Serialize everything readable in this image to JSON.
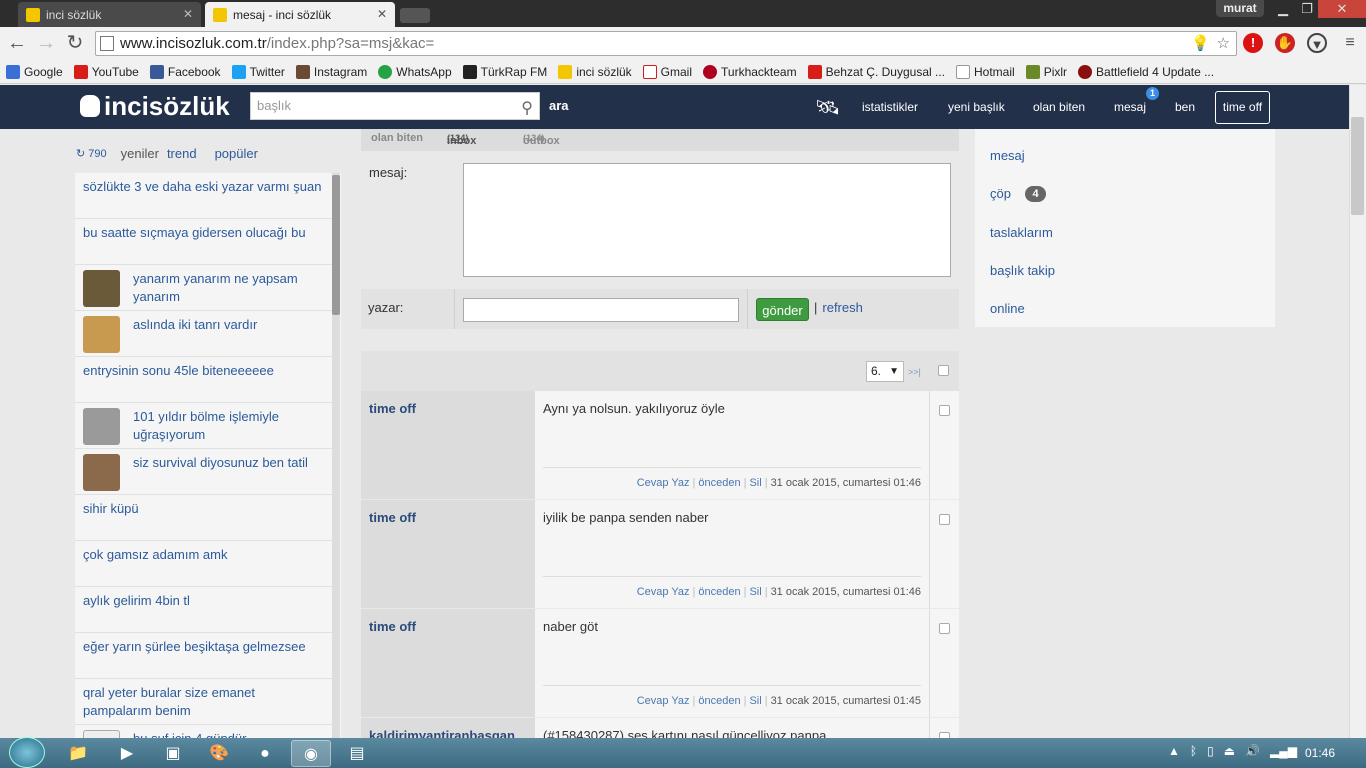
{
  "browser": {
    "tabs": [
      {
        "title": "inci sözlük"
      },
      {
        "title": "mesaj - inci sözlük"
      }
    ],
    "user": "murat",
    "url_host": "www.incisozluk.com.tr",
    "url_path": "/index.php?sa=msj&kac=",
    "bookmarks": [
      {
        "label": "Google",
        "color": "#3b6fd8"
      },
      {
        "label": "YouTube",
        "color": "#d91e18"
      },
      {
        "label": "Facebook",
        "color": "#3b5998"
      },
      {
        "label": "Twitter",
        "color": "#1da1f2"
      },
      {
        "label": "Instagram",
        "color": "#6b4a35"
      },
      {
        "label": "WhatsApp",
        "color": "#25a244"
      },
      {
        "label": "TürkRap FM",
        "color": "#222222"
      },
      {
        "label": "inci sözlük",
        "color": "#f2c600"
      },
      {
        "label": "Gmail",
        "color": "#c5221f"
      },
      {
        "label": "Turkhackteam",
        "color": "#b00020"
      },
      {
        "label": "Behzat Ç. Duygusal ...",
        "color": "#d91e18"
      },
      {
        "label": "Hotmail",
        "color": "#ffffff"
      },
      {
        "label": "Pixlr",
        "color": "#6a8a2a"
      },
      {
        "label": "Battlefield 4 Update ...",
        "color": "#8a1010"
      }
    ]
  },
  "site": {
    "logo": "incisözlük",
    "search_placeholder": "başlık",
    "search_button": "ara",
    "nav": {
      "istatistikler": "istatistikler",
      "yeni_baslik": "yeni başlık",
      "olan_biten": "olan biten",
      "mesaj": "mesaj",
      "mesaj_badge": "1",
      "ben": "ben",
      "time_off": "time off"
    }
  },
  "left": {
    "count": "790",
    "tabs": {
      "yeniler": "yeniler",
      "trend": "trend",
      "populer": "popüler"
    },
    "items": [
      {
        "text": "sözlükte 3 ve daha eski yazar varmı şuan"
      },
      {
        "text": "bu saatte sıçmaya gidersen olucağı bu"
      },
      {
        "text": "yanarım yanarım ne yapsam yanarım"
      },
      {
        "text": "aslında iki tanrı vardır"
      },
      {
        "text": "entrysinin sonu 45le biteneeeeee"
      },
      {
        "text": "101 yıldır bölme işlemiyle uğraşıyorum"
      },
      {
        "text": "siz survival diyosunuz ben tatil"
      },
      {
        "text": "sihir küpü"
      },
      {
        "text": "çok gamsız adamım amk"
      },
      {
        "text": "aylık gelirim 4bin tl"
      },
      {
        "text": "eğer yarın şürlee beşiktaşa gelmezsee"
      },
      {
        "text": "qral yeter buralar size emanet pampalarım benim"
      },
      {
        "text": "bu şuf için 4 gündür"
      }
    ]
  },
  "messages": {
    "tabs": {
      "olan_biten": "olan biten",
      "inbox": "inbox",
      "inbox_count": "(134)",
      "outbox": "outbox",
      "outbox_count": "(134)"
    },
    "form": {
      "mesaj_label": "mesaj:",
      "yazar_label": "yazar:",
      "send": "gönder",
      "sep": "|",
      "refresh": "refresh"
    },
    "pager": {
      "page": "6.",
      "next": ">>|"
    },
    "actions": {
      "reply": "Cevap Yaz",
      "prev": "önceden",
      "delete": "Sil"
    },
    "list": [
      {
        "author": "time off",
        "body": "Aynı ya nolsun. yakılıyoruz öyle",
        "date": "31 ocak 2015, cumartesi 01:46"
      },
      {
        "author": "time off",
        "body": "iyilik be panpa senden naber",
        "date": "31 ocak 2015, cumartesi 01:46"
      },
      {
        "author": "time off",
        "body": "naber göt",
        "date": "31 ocak 2015, cumartesi 01:45"
      },
      {
        "author": "kaldirimyantiranbasgan",
        "body": "(#158430287) ses kartını nasıl güncelliyoz panpa",
        "date": ""
      }
    ]
  },
  "right": {
    "mesaj": "mesaj",
    "cop": "çöp",
    "cop_count": "4",
    "taslaklarim": "taslaklarım",
    "baslik_takip": "başlık takip",
    "online": "online"
  },
  "taskbar": {
    "clock": "01:46"
  },
  "colors": {
    "header": "#22304a",
    "link": "#2c5a9a",
    "send": "#3f9b3f"
  }
}
